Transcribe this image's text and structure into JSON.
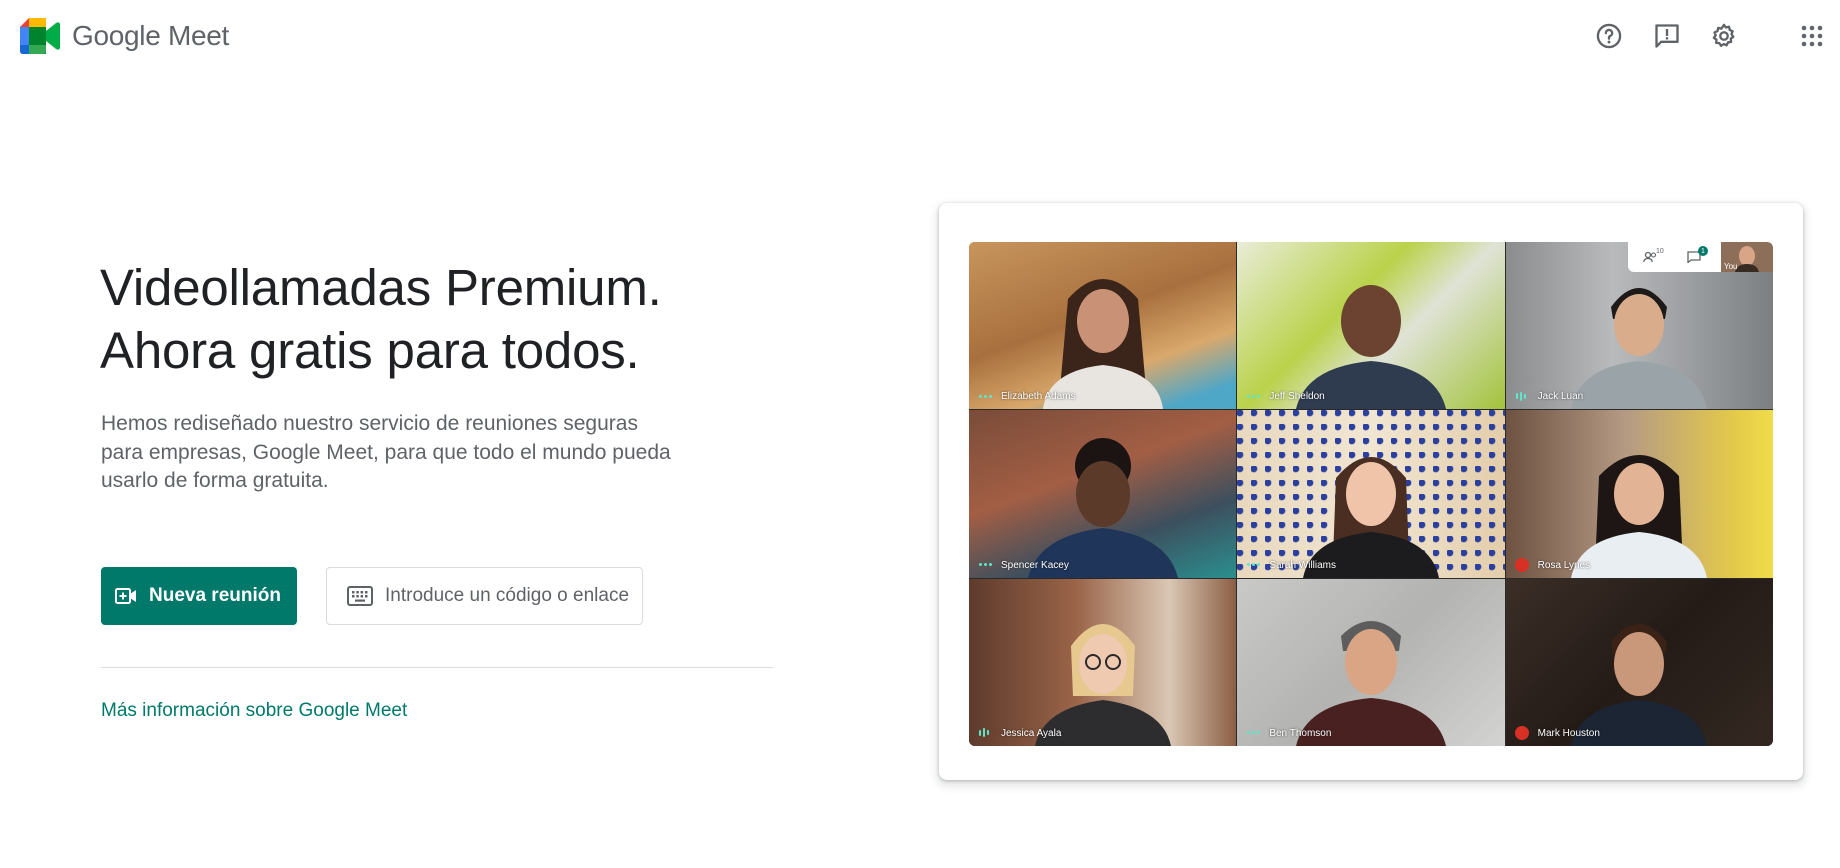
{
  "header": {
    "brand_google": "Google",
    "brand_product": "Meet",
    "icons": [
      "help-icon",
      "feedback-icon",
      "settings-icon",
      "apps-grid-icon"
    ]
  },
  "hero": {
    "headline_line1": "Videollamadas Premium.",
    "headline_line2": "Ahora gratis para todos.",
    "description": "Hemos rediseñado nuestro servicio de reuniones seguras para empresas, Google Meet, para que todo el mundo pueda usarlo de forma gratuita."
  },
  "actions": {
    "new_meeting_label": "Nueva reunión",
    "code_placeholder": "Introduce un código o enlace",
    "more_info_link": "Más información sobre Google Meet"
  },
  "preview": {
    "participants_count": "10",
    "chat_count": "1",
    "you_label": "You",
    "tiles": [
      {
        "name": "Elizabeth Adams",
        "status": "speaking-dots"
      },
      {
        "name": "Jeff Sheldon",
        "status": "speaking-dots"
      },
      {
        "name": "Jack Luan",
        "status": "speaking-bars"
      },
      {
        "name": "Spencer Kacey",
        "status": "speaking-dots"
      },
      {
        "name": "Sarah Williams",
        "status": "speaking-dots"
      },
      {
        "name": "Rosa Lynes",
        "status": "muted"
      },
      {
        "name": "Jessica Ayala",
        "status": "speaking-bars"
      },
      {
        "name": "Ben Thomson",
        "status": "speaking-dots"
      },
      {
        "name": "Mark Houston",
        "status": "muted"
      }
    ]
  },
  "colors": {
    "accent": "#00796b",
    "text_primary": "#202124",
    "text_secondary": "#5f6368",
    "border": "#dadce0"
  }
}
